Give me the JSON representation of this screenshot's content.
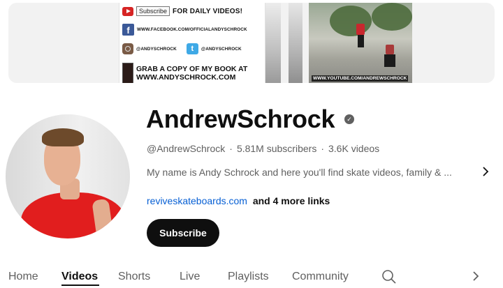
{
  "banner": {
    "subscribe_box": "Subscribe",
    "daily_videos": "FOR DAILY VIDEOS!",
    "facebook_url": "WWW.FACEBOOK.COM/OFFICIALANDYSCHROCK",
    "instagram_handle": "@ANDYSCHROCK",
    "twitter_handle": "@ANDYSCHROCK",
    "book_line1": "GRAB A COPY OF MY BOOK AT",
    "book_line2": "WWW.ANDYSCHROCK.COM",
    "photo_url": "WWW.YOUTUBE.COM/ANDREWSCHROCK"
  },
  "channel": {
    "name": "AndrewSchrock",
    "handle": "@AndrewSchrock",
    "subscribers": "5.81M subscribers",
    "videos": "3.6K videos",
    "description": "My name is Andy Schrock and here you'll find skate videos, family & ...",
    "link": "reviveskateboards.com",
    "more_links": "and 4 more links",
    "subscribe_label": "Subscribe"
  },
  "tabs": [
    {
      "label": "Home"
    },
    {
      "label": "Videos",
      "active": true
    },
    {
      "label": "Shorts"
    },
    {
      "label": "Live"
    },
    {
      "label": "Playlists"
    },
    {
      "label": "Community"
    }
  ],
  "icons": {
    "verified": "verified-check-icon",
    "description_more": "chevron-right-icon",
    "search": "search-icon",
    "tabs_next": "chevron-right-icon"
  }
}
